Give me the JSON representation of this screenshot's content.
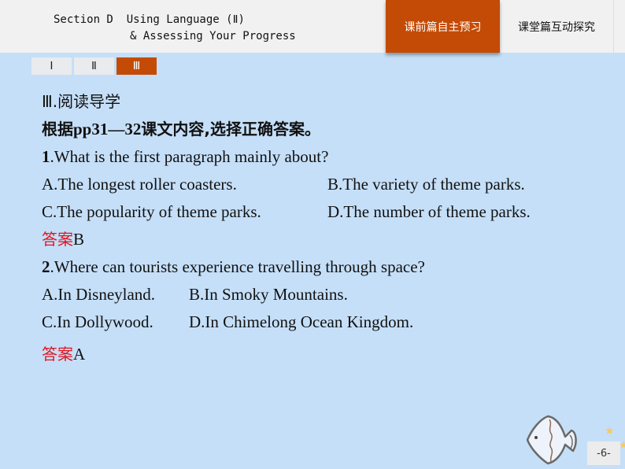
{
  "header": {
    "title_line1": "Section D  Using Language (Ⅱ)",
    "title_line2": "& Assessing Your Progress",
    "tabs": [
      {
        "label": "课前篇自主预习",
        "active": true
      },
      {
        "label": "课堂篇互动探究",
        "active": false
      }
    ]
  },
  "subtabs": [
    {
      "label": "Ⅰ",
      "active": false
    },
    {
      "label": "Ⅱ",
      "active": false
    },
    {
      "label": "Ⅲ",
      "active": true
    }
  ],
  "content": {
    "section_heading": "Ⅲ.阅读导学",
    "instruction_prefix": "根据",
    "instruction_pages": "pp31—32",
    "instruction_suffix": "课文内容,选择正确答案。",
    "questions": [
      {
        "number": "1",
        "text": ".What is the first paragraph mainly about?",
        "options": [
          "A.The longest roller coasters.",
          "B.The variety of theme parks.",
          "C.The popularity of theme parks.",
          "D.The number of theme parks."
        ],
        "answer_label": "答案",
        "answer": "B"
      },
      {
        "number": "2",
        "text": ".Where can tourists experience travelling through space?",
        "options": [
          "A.In Disneyland.",
          "B.In Smoky Mountains.",
          "C.In Dollywood.",
          "D.In Chimelong Ocean Kingdom."
        ],
        "answer_label": "答案",
        "answer": "A"
      }
    ]
  },
  "decoration": {
    "icon": "fish-icon"
  },
  "page_number": "-6-",
  "colors": {
    "accent": "#c44b05",
    "background": "#c5dff8",
    "answer_label": "#e0141e"
  }
}
